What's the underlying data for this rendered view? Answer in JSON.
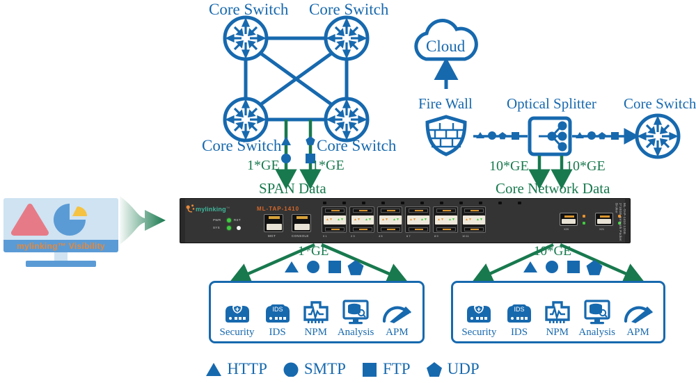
{
  "palette": {
    "blue": "#1769ae",
    "green": "#18794e",
    "chassis": "#343434",
    "orange": "#d8682a",
    "led_green": "#3fcc3f",
    "screen_blue": "#cfe3f2",
    "bar_blue": "#5b9bd5"
  },
  "topology": {
    "core_switches_left": [
      {
        "label": "Core Switch"
      },
      {
        "label": "Core Switch"
      },
      {
        "label": "Core Switch"
      },
      {
        "label": "Core Switch"
      }
    ],
    "cloud": {
      "label": "Cloud"
    },
    "firewall": {
      "label": "Fire Wall"
    },
    "optical_splitter": {
      "label": "Optical Splitter"
    },
    "core_switch_right": {
      "label": "Core Switch"
    },
    "span_flow": {
      "label": "SPAN Data",
      "rate_left": "1*GE",
      "rate_right": "1*GE"
    },
    "core_flow": {
      "label": "Core Network Data",
      "rate_left": "10*GE",
      "rate_right": "10*GE"
    }
  },
  "device": {
    "brand": "mylinking",
    "brand_tm": "™",
    "model": "ML-TAP-1410",
    "leds": [
      {
        "name": "PWR",
        "state": "green"
      },
      {
        "name": "RST",
        "state": "white"
      },
      {
        "name": "SYS",
        "state": "green"
      }
    ],
    "mgmt_ports": [
      {
        "caption": "MGT"
      },
      {
        "caption": "CONSOLE"
      }
    ],
    "port_groups": [
      {
        "caption": "0   1"
      },
      {
        "caption": "2   3"
      },
      {
        "caption": "4   5"
      },
      {
        "caption": "6   7"
      },
      {
        "caption": "8   9"
      },
      {
        "caption": "10  11"
      }
    ],
    "sfp_ports": [
      {
        "caption": "X20"
      },
      {
        "caption": "X21"
      }
    ],
    "side_text": "ML-TAP-1410 12GE 2*10GE Network Packet Broker"
  },
  "output": {
    "left_rate": "1*GE",
    "right_rate": "10*GE",
    "left_tools": [
      {
        "label": "Security",
        "icon": "shield-appliance-icon"
      },
      {
        "label": "IDS",
        "icon": "ids-appliance-icon"
      },
      {
        "label": "NPM",
        "icon": "npm-monitor-icon"
      },
      {
        "label": "Analysis",
        "icon": "analysis-database-monitor-icon"
      },
      {
        "label": "APM",
        "icon": "apm-gauge-icon"
      }
    ],
    "right_tools": [
      {
        "label": "Security",
        "icon": "shield-appliance-icon"
      },
      {
        "label": "IDS",
        "icon": "ids-appliance-icon"
      },
      {
        "label": "NPM",
        "icon": "npm-monitor-icon"
      },
      {
        "label": "Analysis",
        "icon": "analysis-database-monitor-icon"
      },
      {
        "label": "APM",
        "icon": "apm-gauge-icon"
      }
    ]
  },
  "visibility_monitor": {
    "caption": "mylinking™ Visibility",
    "chart_shapes": [
      "triangle",
      "pie"
    ]
  },
  "legend": [
    {
      "shape": "triangle",
      "label": "HTTP"
    },
    {
      "shape": "circle",
      "label": "SMTP"
    },
    {
      "shape": "square",
      "label": "FTP"
    },
    {
      "shape": "pentagon",
      "label": "UDP"
    }
  ],
  "ids_badge": "IDS"
}
